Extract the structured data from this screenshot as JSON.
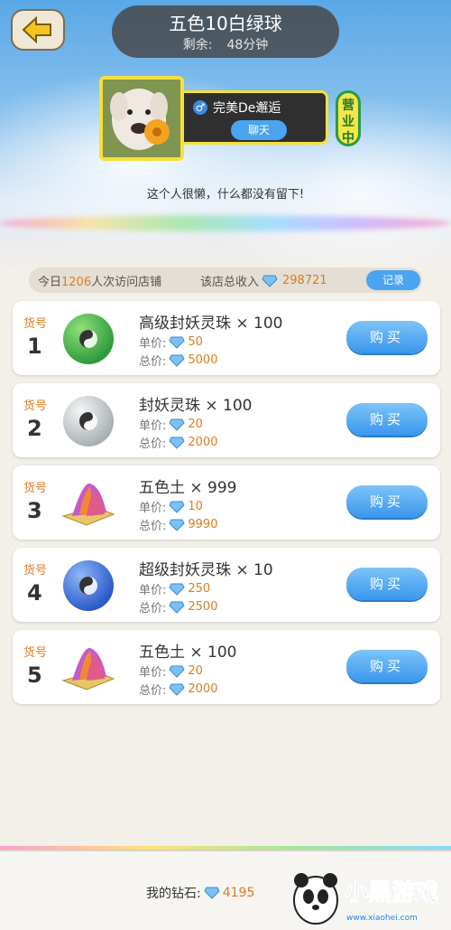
{
  "header": {
    "title": "五色10白绿球",
    "remaining_label": "剩余:",
    "remaining_value": "48分钟"
  },
  "owner": {
    "name": "完美De邂逅",
    "chat_label": "聊天",
    "status": "营业中",
    "signature": "这个人很懒，什么都没有留下!"
  },
  "stats": {
    "visits_prefix": "今日",
    "visits_count": "1206",
    "visits_suffix": "人次访问店铺",
    "income_label": "该店总收入",
    "income_value": "298721",
    "record_label": "记录"
  },
  "items": [
    {
      "label": "货号",
      "no": "1",
      "name": "高级封妖灵珠 × 100",
      "unit_label": "单价:",
      "unit": "50",
      "total_label": "总价:",
      "total": "5000",
      "buy": "购买",
      "icon": "green-orb-icon"
    },
    {
      "label": "货号",
      "no": "2",
      "name": "封妖灵珠 × 100",
      "unit_label": "单价:",
      "unit": "20",
      "total_label": "总价:",
      "total": "2000",
      "buy": "购买",
      "icon": "white-orb-icon"
    },
    {
      "label": "货号",
      "no": "3",
      "name": "五色土 × 999",
      "unit_label": "单价:",
      "unit": "10",
      "total_label": "总价:",
      "total": "9990",
      "buy": "购买",
      "icon": "five-color-earth-icon"
    },
    {
      "label": "货号",
      "no": "4",
      "name": "超级封妖灵珠 × 10",
      "unit_label": "单价:",
      "unit": "250",
      "total_label": "总价:",
      "total": "2500",
      "buy": "购买",
      "icon": "blue-orb-icon"
    },
    {
      "label": "货号",
      "no": "5",
      "name": "五色土 × 100",
      "unit_label": "单价:",
      "unit": "20",
      "total_label": "总价:",
      "total": "2000",
      "buy": "购买",
      "icon": "five-color-earth-icon"
    }
  ],
  "footer": {
    "diamond_label": "我的钻石:",
    "diamond_value": "4195"
  },
  "watermark": {
    "brand": "小黑游戏",
    "url": "www.xiaohei.com"
  },
  "colors": {
    "accent": "#4aa4f0",
    "value": "#e07a20",
    "badge": "#f4e646"
  }
}
